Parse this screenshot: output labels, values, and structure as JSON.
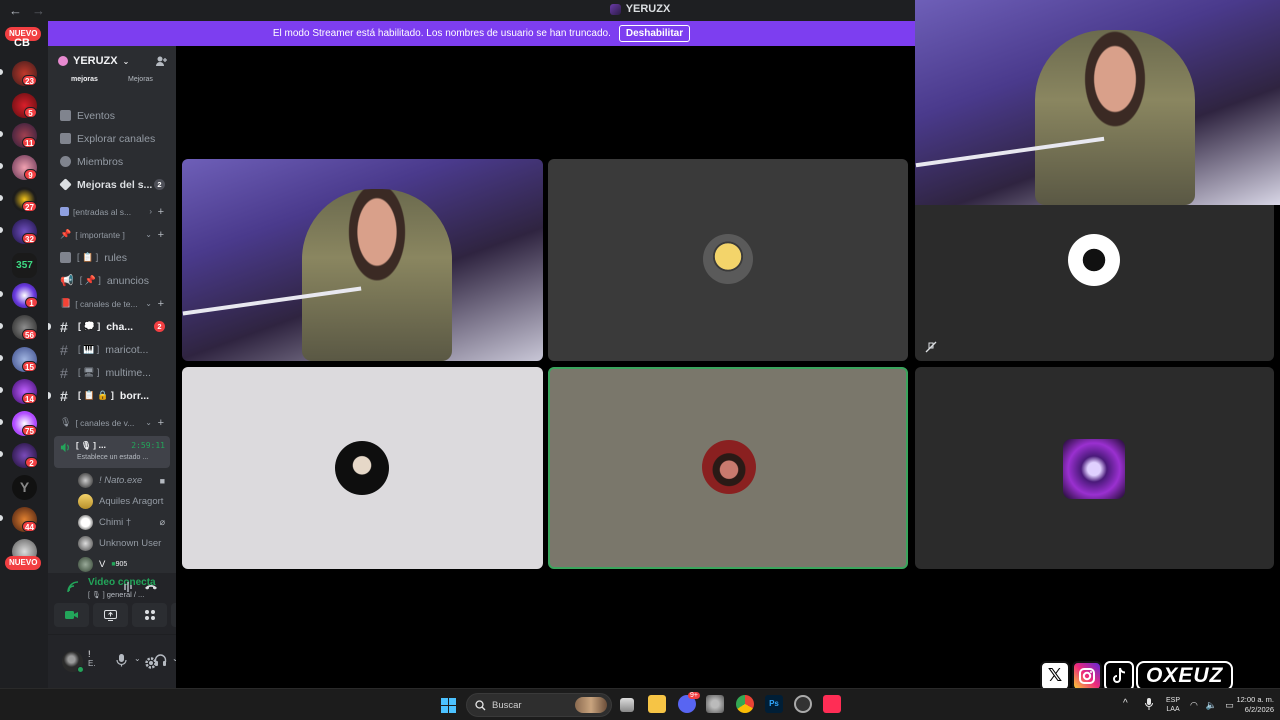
{
  "window": {
    "title": "YERUZX",
    "back_glyph": "←",
    "forward_glyph": "→"
  },
  "banner": {
    "text": "El modo Streamer está habilitado. Los nombres de usuario se han truncado.",
    "button": "Deshabilitar",
    "color": "#7d3ef0"
  },
  "rail": {
    "nuevo_top": "NUEVO",
    "nuevo_bottom": "NUEVO",
    "first_label": "CB",
    "badges": [
      "23",
      "5",
      "11",
      "9",
      "27",
      "32",
      "1",
      "56",
      "15",
      "14",
      "75",
      "2",
      "44"
    ]
  },
  "server": {
    "name": "YERUZX",
    "boost_left": "mejoras",
    "boost_right": "Mejoras"
  },
  "nav": {
    "events": "Eventos",
    "browse": "Explorar canales",
    "members": "Miembros",
    "boosts": "Mejoras del s...",
    "boosts_badge": "2"
  },
  "categories": {
    "c1": "[entradas al s...",
    "c2": "[ importante ]",
    "c3": "[ canales de te...",
    "c4": "[ canales de v..."
  },
  "channels": {
    "rules": "rules",
    "anuncios": "anuncios",
    "chat": "cha...",
    "chat_badge": "2",
    "maricot": "maricot...",
    "multimedia": "multime...",
    "borr": "borr..."
  },
  "voice_channel": {
    "name": "...",
    "time": "2:59:11",
    "status": "Establece un estado ..."
  },
  "voice_users": [
    {
      "name": "! Nato.exe",
      "right": "■"
    },
    {
      "name": "Aquiles Aragort",
      "right": ""
    },
    {
      "name": "Chimi †",
      "right": "⌀"
    },
    {
      "name": "Unknown User",
      "right": ""
    },
    {
      "name": "V",
      "right": ""
    }
  ],
  "voice_users_extra": "905",
  "voice_panel": {
    "status": "Video conectado",
    "sub": "general / ..."
  },
  "user_panel": {
    "name": "!",
    "tag": "E."
  },
  "taskbar": {
    "search": "Buscar",
    "lang_1": "ESP",
    "lang_2": "LAA",
    "time": "12:00 a. m.",
    "date": "6/2/2026",
    "discord_badge": "9+"
  },
  "overlay": {
    "brand": "OXEUZ"
  }
}
